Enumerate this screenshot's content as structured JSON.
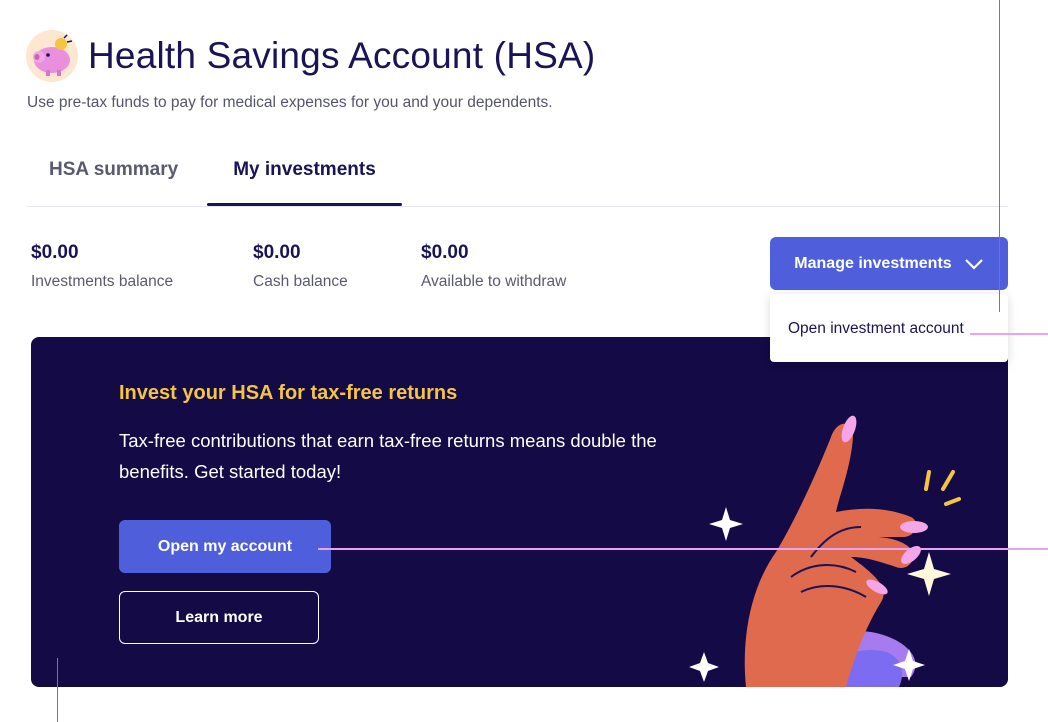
{
  "page": {
    "title": "Health Savings Account (HSA)",
    "subtitle": "Use pre-tax funds to pay for medical expenses for you and your dependents.",
    "logo_icon": "piggy-bank-icon"
  },
  "tabs": [
    {
      "label": "HSA summary",
      "active": false
    },
    {
      "label": "My investments",
      "active": true
    }
  ],
  "balances": [
    {
      "value": "$0.00",
      "label": "Investments balance"
    },
    {
      "value": "$0.00",
      "label": "Cash balance"
    },
    {
      "value": "$0.00",
      "label": "Available to withdraw"
    }
  ],
  "manage": {
    "label": "Manage investments",
    "icon": "chevron-down-icon",
    "menu_items": [
      "Open investment account"
    ]
  },
  "promo": {
    "headline": "Invest your HSA for tax-free returns",
    "body": "Tax-free contributions that earn tax-free returns means double the benefits. Get started today!",
    "primary_label": "Open my account",
    "secondary_label": "Learn more",
    "illustration_icon": "snapping-hand-illustration"
  },
  "colors": {
    "accent": "#4f5fdc",
    "navy": "#1a1456",
    "banner_bg": "#140a45",
    "headline_yellow": "#f5c542"
  }
}
